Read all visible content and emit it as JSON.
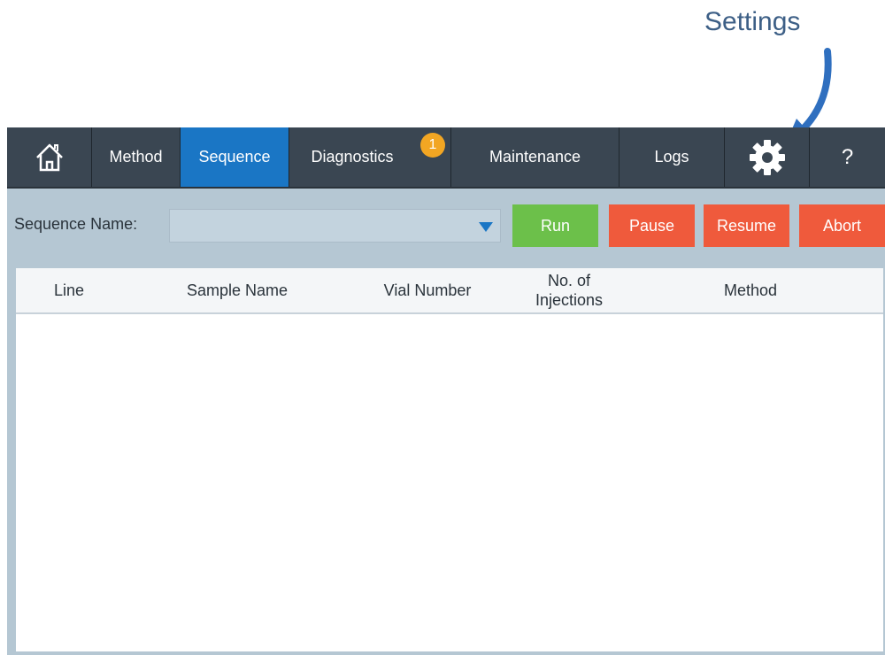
{
  "callout": {
    "label": "Settings"
  },
  "nav": {
    "tabs": [
      {
        "id": "home",
        "icon": "home-icon"
      },
      {
        "id": "method",
        "label": "Method"
      },
      {
        "id": "sequence",
        "label": "Sequence",
        "active": true
      },
      {
        "id": "diagnostics",
        "label": "Diagnostics",
        "badge": "1"
      },
      {
        "id": "maintenance",
        "label": "Maintenance"
      },
      {
        "id": "logs",
        "label": "Logs"
      },
      {
        "id": "settings",
        "icon": "gear-icon"
      },
      {
        "id": "help",
        "label": "?"
      }
    ]
  },
  "toolbar": {
    "sequence_label": "Sequence Name:",
    "sequence_value": "",
    "run_label": "Run",
    "pause_label": "Pause",
    "resume_label": "Resume",
    "abort_label": "Abort"
  },
  "table": {
    "columns": [
      "Line",
      "Sample Name",
      "Vial Number",
      "No. of\nInjections",
      "Method"
    ],
    "rows": []
  },
  "colors": {
    "nav_bg": "#3a4652",
    "active_tab": "#1a76c5",
    "badge": "#f2a623",
    "run": "#6cc04a",
    "stop": "#ef5a3c",
    "app_bg": "#b5c7d3",
    "callout": "#3d5f86"
  }
}
